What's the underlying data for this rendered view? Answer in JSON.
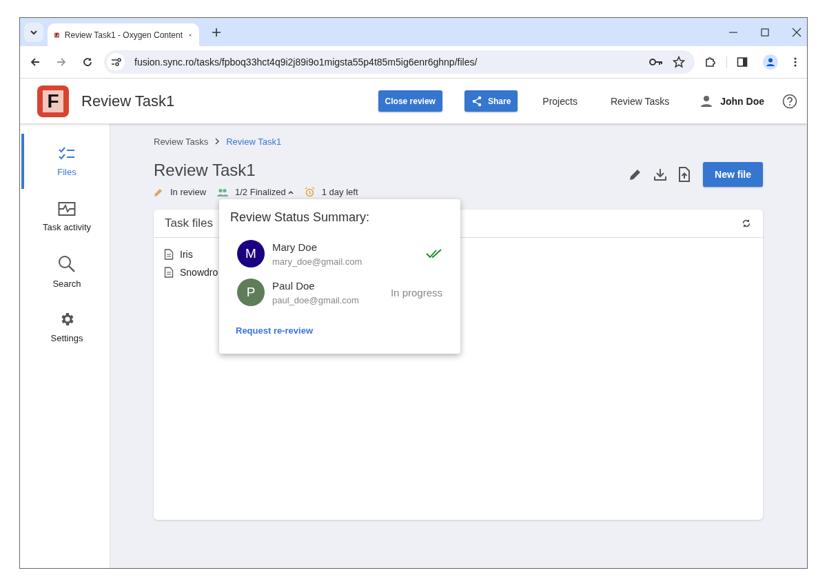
{
  "browser": {
    "tab_title": "Review Task1 - Oxygen Content",
    "url": "fusion.sync.ro/tasks/fpboq33hct4q9i2j89i9o1migsta55p4t85m5ig6enr6ghnp/files/"
  },
  "header": {
    "logo_letter": "F",
    "title": "Review Task1",
    "close_review": "Close review",
    "share": "Share",
    "nav": [
      "Projects",
      "Review Tasks"
    ],
    "user": "John Doe"
  },
  "sidebar": {
    "items": [
      {
        "label": "Files",
        "kind": "checklist",
        "selected": true
      },
      {
        "label": "Task activity",
        "kind": "activity",
        "selected": false
      },
      {
        "label": "Search",
        "kind": "search",
        "selected": false
      },
      {
        "label": "Settings",
        "kind": "settings",
        "selected": false
      }
    ]
  },
  "breadcrumb": [
    "Review Tasks",
    "Review Task1"
  ],
  "task": {
    "title": "Review Task1",
    "status": "In review",
    "finalized": "1/2 Finalized",
    "time_left": "1 day left",
    "new_file": "New file"
  },
  "files_panel": {
    "title": "Task files",
    "files": [
      "Iris",
      "Snowdro"
    ]
  },
  "popup": {
    "title": "Review Status Summary:",
    "reviewers": [
      {
        "initial": "M",
        "name": "Mary Doe",
        "email": "mary_doe@gmail.com",
        "color": "#1a0080",
        "kind": "finalized"
      },
      {
        "initial": "P",
        "name": "Paul Doe",
        "email": "paul_doe@gmail.com",
        "color": "#5e7d58",
        "kind": "in_progress",
        "status": "In progress"
      }
    ],
    "link": "Request re-review"
  }
}
